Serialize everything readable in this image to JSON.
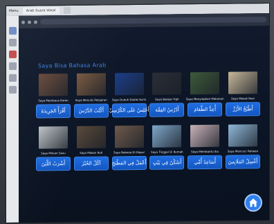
{
  "os_bar": {
    "menu_label": "Menu",
    "tabs": [
      {
        "label": "Arab Suara Vokal"
      },
      {
        "label": ""
      }
    ]
  },
  "browser": {
    "url": ""
  },
  "app": {
    "title": "Saya Bisa Bahasa Arab",
    "cards": [
      {
        "caption": "Saya Membaca Koran",
        "arabic": "أَقْرَأُ الجَرِيدَةَ",
        "icon": "reading-newspaper-image",
        "color": "#6a4a3a"
      },
      {
        "caption": "Saya Menulis Pelajaran",
        "arabic": "أَكْتُبُ الدَّرْسَ",
        "icon": "writing-lesson-image",
        "color": "#7a5a40"
      },
      {
        "caption": "Saya Duduk Diatas Kursi",
        "arabic": "أَجْلِسُ عَلَى الكُرْسِيِّ",
        "icon": "sitting-chair-image",
        "color": "#1b3e8a"
      },
      {
        "caption": "Saya Belajar Fiqh",
        "arabic": "أَدْرُسُ الفِقْهَ",
        "icon": "studying-fiqh-image",
        "color": "#2a2e36"
      },
      {
        "caption": "Saya Menyiapkan Makanan",
        "arabic": "أُعِدُّ الطَّعَامَ",
        "icon": "preparing-food-image",
        "color": "#3e5a3a"
      },
      {
        "caption": "Saya Masak Nasi",
        "arabic": "أَطْبُخُ الأَرُزَّ",
        "icon": "cooking-rice-image",
        "color": "#c8b89a"
      },
      {
        "caption": "Saya Minum Susu",
        "arabic": "أَشْرَبُ اللَّبَنَ",
        "icon": "drinking-milk-image",
        "color": "#bfc4c8"
      },
      {
        "caption": "Saya Makan Roti",
        "arabic": "آكُلُ الخُبْزَ",
        "icon": "eating-bread-image",
        "color": "#5a4a3a"
      },
      {
        "caption": "Saya Bekerja Di Dapur",
        "arabic": "أَعْمَلُ فِي المَطْبَخِ",
        "icon": "kitchen-work-image",
        "color": "#6e5a4a"
      },
      {
        "caption": "Saya Tinggal Di Rumah",
        "arabic": "أَسْكُنُ فِي بَيْتٍ",
        "icon": "house-image",
        "color": "#7fa7c9"
      },
      {
        "caption": "Saya Membantu Ibu",
        "arabic": "أُسَاعِدُ أُمِّي",
        "icon": "helping-mother-image",
        "color": "#c9b2b8"
      },
      {
        "caption": "Saya Mencuci Pakaian",
        "arabic": "أَغْسِلُ المَلَابِسَ",
        "icon": "washing-clothes-image",
        "color": "#8fb8d8"
      }
    ]
  },
  "colors": {
    "accent": "#2f80ed",
    "button": "#1a63d6",
    "title": "#3f7fe0"
  }
}
